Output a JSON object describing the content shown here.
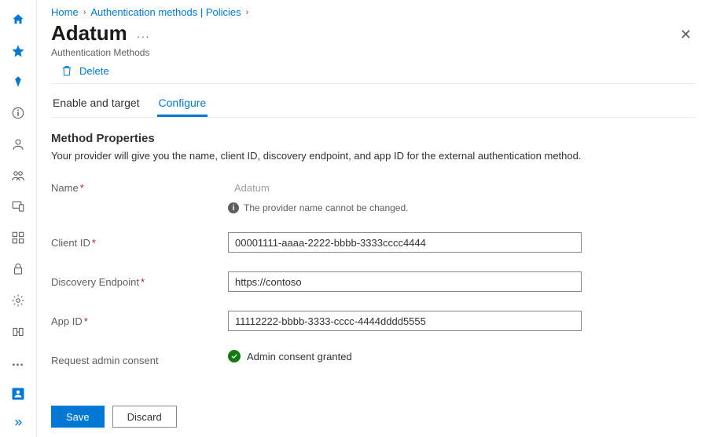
{
  "breadcrumb": {
    "home": "Home",
    "auth_methods": "Authentication methods | Policies"
  },
  "header": {
    "title": "Adatum",
    "subtitle": "Authentication Methods"
  },
  "toolbar": {
    "delete_label": "Delete"
  },
  "tabs": {
    "enable_target": "Enable and target",
    "configure": "Configure"
  },
  "section": {
    "title": "Method Properties",
    "description": "Your provider will give you the name, client ID, discovery endpoint, and app ID for the external authentication method."
  },
  "form": {
    "name": {
      "label": "Name",
      "value": "Adatum",
      "info": "The provider name cannot be changed."
    },
    "client_id": {
      "label": "Client ID",
      "value": "00001111-aaaa-2222-bbbb-3333cccc4444"
    },
    "discovery": {
      "label": "Discovery Endpoint",
      "value": "https://contoso"
    },
    "app_id": {
      "label": "App ID",
      "value": "11112222-bbbb-3333-cccc-4444dddd5555"
    },
    "consent": {
      "label": "Request admin consent",
      "status": "Admin consent granted"
    }
  },
  "footer": {
    "save": "Save",
    "discard": "Discard"
  }
}
